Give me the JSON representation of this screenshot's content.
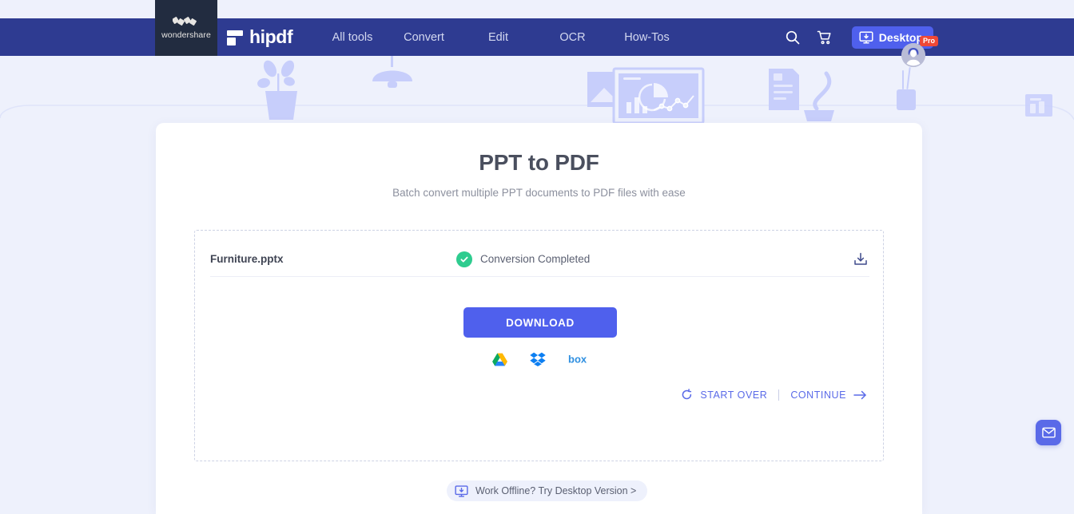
{
  "brand": {
    "corner_name": "wondershare",
    "logo_text": "hipdf",
    "corner_icon": "wondershare-w-icon",
    "logo_icon": "hipdf-mark-icon"
  },
  "nav": {
    "items": [
      {
        "label": "All tools"
      },
      {
        "label": "Convert"
      },
      {
        "label": "Edit"
      },
      {
        "label": "OCR"
      },
      {
        "label": "How-Tos"
      }
    ],
    "search_icon": "search-icon",
    "cart_icon": "cart-icon",
    "desktop_button": {
      "label": "Desktop",
      "icon": "desktop-download-icon"
    },
    "account": {
      "badge": "Pro",
      "icon": "avatar-icon"
    }
  },
  "page": {
    "title": "PPT to PDF",
    "subtitle": "Batch convert multiple PPT documents to PDF files with ease"
  },
  "file_row": {
    "name": "Furniture.pptx",
    "status": "Conversion Completed",
    "status_icon": "check-circle-icon",
    "download_icon": "download-tray-icon"
  },
  "download": {
    "button_label": "DOWNLOAD",
    "cloud_targets": [
      {
        "name": "google-drive-icon",
        "label": "Google Drive"
      },
      {
        "name": "dropbox-icon",
        "label": "Dropbox"
      },
      {
        "name": "box-icon",
        "label": "Box"
      }
    ]
  },
  "actions": {
    "start_over": {
      "label": "START OVER",
      "icon": "refresh-ccw-icon"
    },
    "continue": {
      "label": "CONTINUE",
      "icon": "arrow-right-icon"
    }
  },
  "offline": {
    "label": "Work Offline? Try Desktop Version >",
    "icon": "desktop-download-icon"
  },
  "feedback": {
    "icon": "envelope-icon"
  },
  "colors": {
    "navbar": "#2e3b91",
    "page_bg": "#eef1fc",
    "accent": "#4f60ed",
    "link": "#5a6ae8",
    "success": "#2ecc8f",
    "pro_badge": "#ef4836",
    "corner_dark": "#222c40"
  }
}
